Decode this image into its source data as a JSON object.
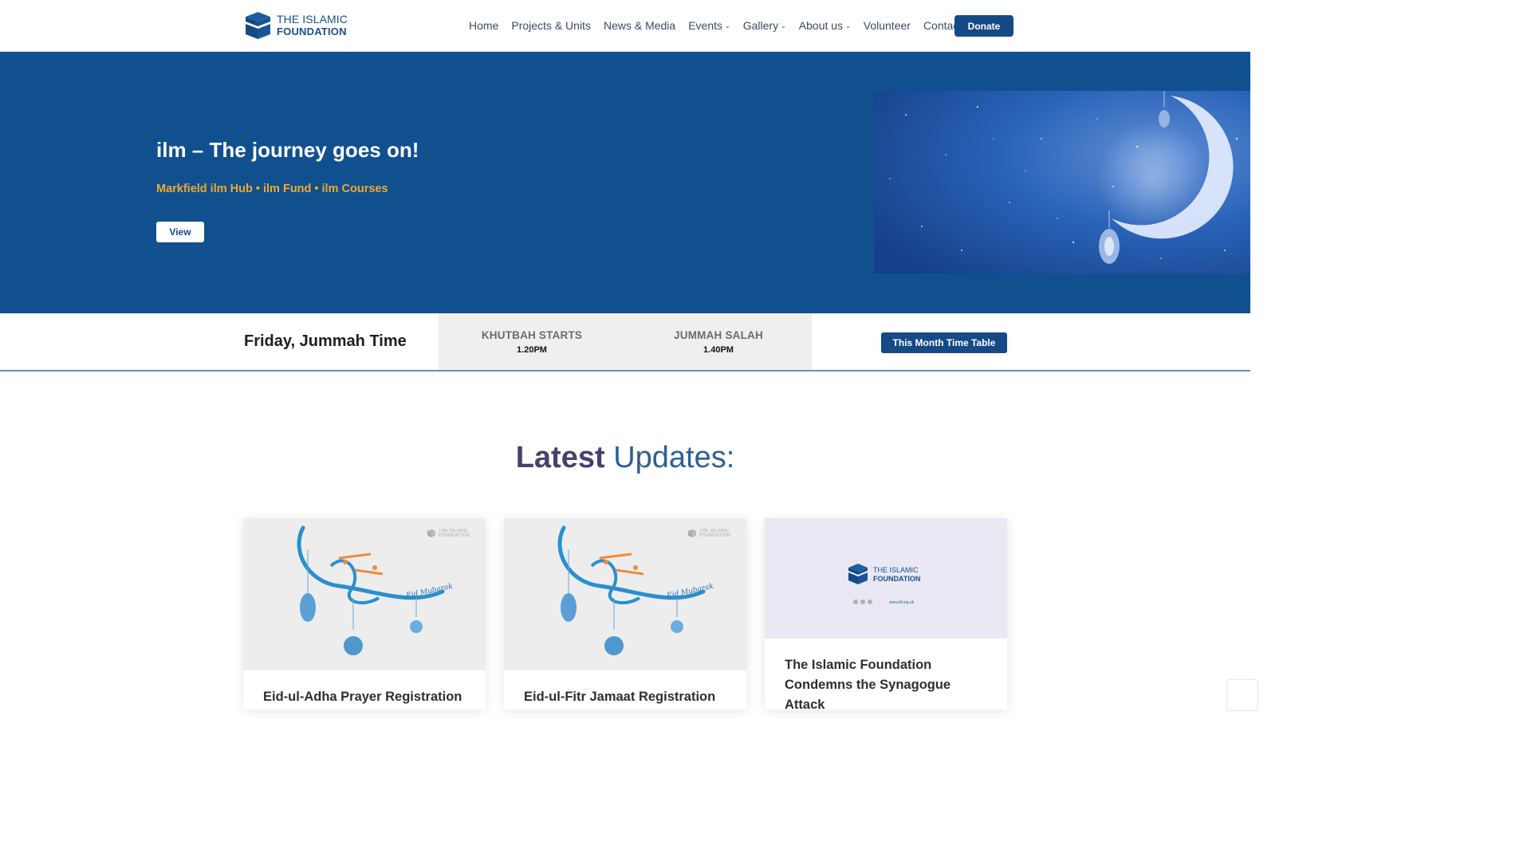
{
  "brand": {
    "line1": "THE ISLAMIC",
    "line2": "FOUNDATION"
  },
  "nav": [
    {
      "label": "Home",
      "dropdown": false
    },
    {
      "label": "Projects & Units",
      "dropdown": false
    },
    {
      "label": "News & Media",
      "dropdown": false
    },
    {
      "label": "Events",
      "dropdown": true
    },
    {
      "label": "Gallery",
      "dropdown": true
    },
    {
      "label": "About us",
      "dropdown": true
    },
    {
      "label": "Volunteer",
      "dropdown": false
    },
    {
      "label": "Contact",
      "dropdown": false
    }
  ],
  "donate_label": "Donate",
  "hero": {
    "title": "ilm – The journey goes on!",
    "subtitle": "Markfield ilm Hub • ilm Fund • ilm Courses",
    "button_label": "View"
  },
  "jummah": {
    "title": "Friday, Jummah Time",
    "khutbah_label": "KHUTBAH STARTS",
    "khutbah_time": "1.20PM",
    "salah_label": "JUMMAH SALAH",
    "salah_time": "1.40PM",
    "timetable_label": "This Month Time Table"
  },
  "latest": {
    "word1": "Latest",
    "word2": "Updates:"
  },
  "cards": [
    {
      "title": "Eid-ul-Adha Prayer Registration"
    },
    {
      "title": "Eid-ul-Fitr Jamaat Registration"
    },
    {
      "title": "The Islamic Foundation Condemns the Synagogue Attack"
    }
  ],
  "card_image": {
    "eid_text": "Eid Mubarak",
    "logo_line1": "THE ISLAMIC",
    "logo_line2": "FOUNDATION",
    "url_text": "www.tif.org.uk"
  },
  "colors": {
    "primary": "#154a87",
    "hero_bg": "#11508f",
    "accent": "#f0a92a"
  }
}
